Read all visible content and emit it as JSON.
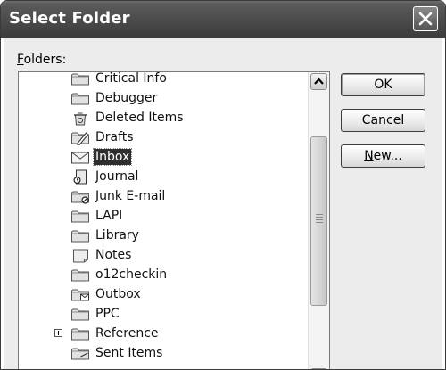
{
  "window": {
    "title": "Select Folder"
  },
  "folders_label": {
    "accel": "F",
    "rest": "olders:"
  },
  "tree": {
    "items": [
      {
        "label": "Critical Info",
        "icon": "folder-icon"
      },
      {
        "label": "Debugger",
        "icon": "folder-icon"
      },
      {
        "label": "Deleted Items",
        "icon": "deleted-items-icon"
      },
      {
        "label": "Drafts",
        "icon": "drafts-icon"
      },
      {
        "label": "Inbox",
        "icon": "inbox-icon",
        "selected": true
      },
      {
        "label": "Journal",
        "icon": "journal-icon"
      },
      {
        "label": "Junk E-mail",
        "icon": "junk-email-icon"
      },
      {
        "label": "LAPI",
        "icon": "folder-icon"
      },
      {
        "label": "Library",
        "icon": "folder-icon"
      },
      {
        "label": "Notes",
        "icon": "notes-icon"
      },
      {
        "label": "o12checkin",
        "icon": "folder-icon"
      },
      {
        "label": "Outbox",
        "icon": "outbox-icon"
      },
      {
        "label": "PPC",
        "icon": "folder-icon"
      },
      {
        "label": "Reference",
        "icon": "folder-icon",
        "expandable": true
      },
      {
        "label": "Sent Items",
        "icon": "sent-items-icon"
      }
    ]
  },
  "buttons": {
    "ok": "OK",
    "cancel": "Cancel",
    "new_accel": "N",
    "new_rest": "ew..."
  }
}
